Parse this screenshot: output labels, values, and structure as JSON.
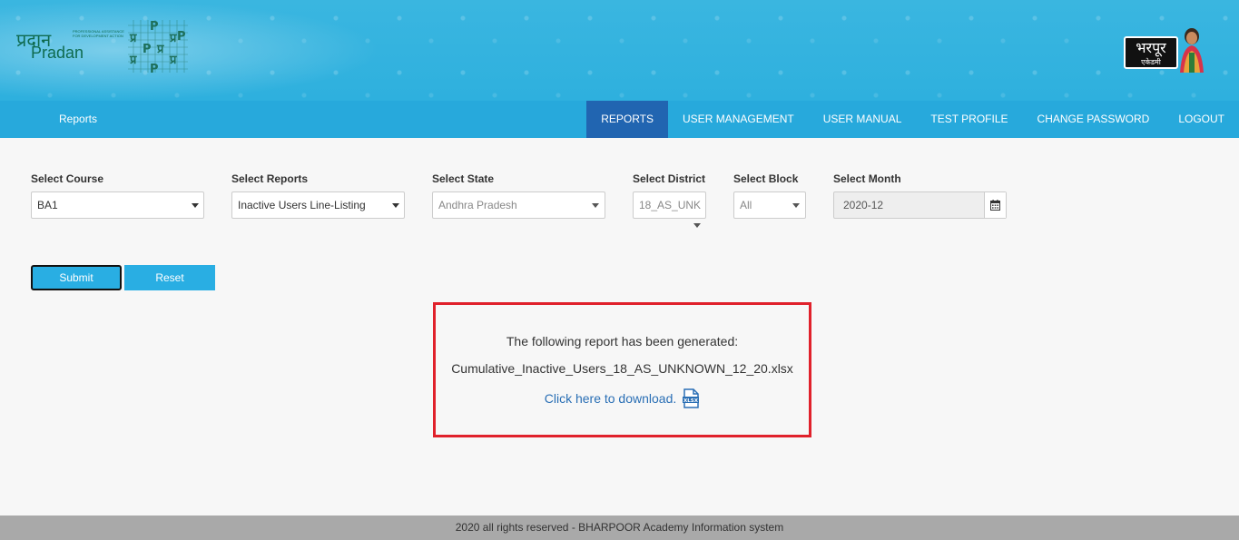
{
  "header": {
    "logo_left_hindi": "प्रदान",
    "logo_left_english": "Pradan",
    "logo_left_tagline": "PROFESSIONAL ASSISTANCE FOR DEVELOPMENT ACTION",
    "logo_right_hindi": "भरपूर",
    "logo_right_sub": "एकेडमी"
  },
  "navbar": {
    "brand": "Reports",
    "items": [
      {
        "label": "REPORTS",
        "active": true
      },
      {
        "label": "USER MANAGEMENT"
      },
      {
        "label": "USER MANUAL"
      },
      {
        "label": "TEST PROFILE"
      },
      {
        "label": "CHANGE PASSWORD"
      },
      {
        "label": "LOGOUT"
      }
    ]
  },
  "filters": {
    "course": {
      "label": "Select Course",
      "value": "BA1"
    },
    "reports": {
      "label": "Select Reports",
      "value": "Inactive Users Line-Listing"
    },
    "state": {
      "label": "Select State",
      "value": "Andhra Pradesh"
    },
    "district": {
      "label": "Select District",
      "value": "18_AS_UNK"
    },
    "block": {
      "label": "Select Block",
      "value": "All"
    },
    "month": {
      "label": "Select Month",
      "value": "2020-12"
    }
  },
  "buttons": {
    "submit": "Submit",
    "reset": "Reset"
  },
  "report": {
    "message": "The following report has been generated:",
    "filename": "Cumulative_Inactive_Users_18_AS_UNKNOWN_12_20.xlsx",
    "download_link": "Click here to download.",
    "file_icon_label": "XLSX"
  },
  "footer": {
    "text": "2020 all rights reserved - BHARPOOR Academy Information system"
  },
  "colors": {
    "nav_bg": "#27a9dc",
    "nav_active": "#2165b1",
    "button": "#29aee3",
    "report_border": "#e0212b",
    "link": "#2a6fb5"
  }
}
